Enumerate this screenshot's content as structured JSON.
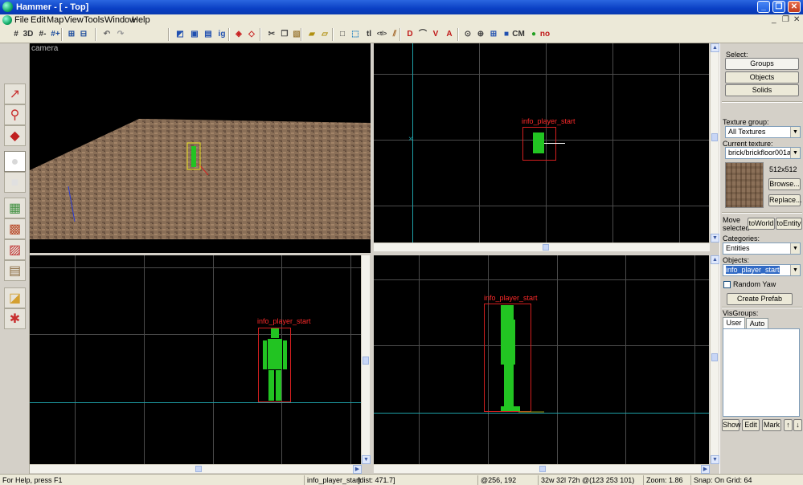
{
  "window": {
    "title": "Hammer - [ - Top]",
    "minimize": "_",
    "restore": "❐",
    "close": "✕"
  },
  "menu": {
    "items": [
      "File",
      "Edit",
      "Map",
      "View",
      "Tools",
      "Window",
      "Help"
    ],
    "mdi_min": "_",
    "mdi_restore": "❐",
    "mdi_close": "✕"
  },
  "toolbar": {
    "buttons": [
      {
        "name": "grid-toggle-icon",
        "glyph": "#"
      },
      {
        "name": "3d-grid-icon",
        "glyph": "3D"
      },
      {
        "name": "grid-smaller-icon",
        "glyph": "#-"
      },
      {
        "name": "grid-larger-icon",
        "glyph": "#+"
      },
      {
        "name": "group-icon",
        "glyph": "⊞"
      },
      {
        "name": "ungroup-icon",
        "glyph": "⊟"
      },
      {
        "name": "undo-icon",
        "glyph": "↶"
      },
      {
        "name": "redo-icon",
        "glyph": "↷"
      },
      {
        "name": "compile-icon",
        "glyph": "◩"
      },
      {
        "name": "hide-selection-icon",
        "glyph": "▣"
      },
      {
        "name": "show-all-icon",
        "glyph": "▤"
      },
      {
        "name": "ig-icon",
        "glyph": "ig"
      },
      {
        "name": "carve-icon",
        "glyph": "◈"
      },
      {
        "name": "make-hollow-icon",
        "glyph": "◇"
      },
      {
        "name": "cut-icon",
        "glyph": "✂"
      },
      {
        "name": "copy-icon",
        "glyph": "❐"
      },
      {
        "name": "paste-icon",
        "glyph": "▧"
      },
      {
        "name": "texture-lock-icon",
        "glyph": "▰"
      },
      {
        "name": "texture-scale-lock-icon",
        "glyph": "▱"
      },
      {
        "name": "select-box-icon",
        "glyph": "□"
      },
      {
        "name": "select-cursor-icon",
        "glyph": "⬚"
      },
      {
        "name": "texture-apply-icon",
        "glyph": "tl"
      },
      {
        "name": "flip-icon",
        "glyph": "<tl>"
      },
      {
        "name": "clip-icon",
        "glyph": "⫽"
      },
      {
        "name": "toggle-3d-red-icon",
        "glyph": "D"
      },
      {
        "name": "vertex-icon",
        "glyph": "⌒"
      },
      {
        "name": "toggle-models-icon",
        "glyph": "V"
      },
      {
        "name": "toggle-helpers-icon",
        "glyph": "A"
      },
      {
        "name": "cordon-icon",
        "glyph": "⊙"
      },
      {
        "name": "autovis-icon",
        "glyph": "⊕"
      },
      {
        "name": "grid-3d-icon",
        "glyph": "⊞"
      },
      {
        "name": "color-icon",
        "glyph": "■"
      },
      {
        "name": "cm-icon",
        "glyph": "CM"
      },
      {
        "name": "leaf-icon",
        "glyph": "●"
      },
      {
        "name": "no-draw-icon",
        "glyph": "no"
      }
    ]
  },
  "palette": {
    "tools": [
      {
        "name": "selection-tool-icon",
        "glyph": "↗"
      },
      {
        "name": "magnify-tool-icon",
        "glyph": "⚲"
      },
      {
        "name": "camera-tool-icon",
        "glyph": "◆"
      },
      {
        "name": "entity-tool-icon",
        "glyph": "●"
      },
      {
        "name": "block-tool-icon",
        "glyph": "■"
      },
      {
        "name": "texture-tool-icon",
        "glyph": "▦"
      },
      {
        "name": "apply-texture-tool-icon",
        "glyph": "▩"
      },
      {
        "name": "decal-tool-icon",
        "glyph": "▨"
      },
      {
        "name": "overlay-tool-icon",
        "glyph": "▤"
      },
      {
        "name": "clip-tool-icon",
        "glyph": "◪"
      },
      {
        "name": "vertex-tool-icon",
        "glyph": "✱"
      }
    ]
  },
  "viewports": {
    "camera": {
      "label": "camera"
    },
    "top": {
      "entity_label": "info_player_start"
    },
    "front": {
      "entity_label": "info_player_start"
    },
    "side": {
      "entity_label": "info_player_start"
    }
  },
  "right_panel": {
    "select_label": "Select:",
    "select_buttons": [
      "Groups",
      "Objects",
      "Solids"
    ],
    "texture_group_label": "Texture group:",
    "texture_group_value": "All Textures",
    "current_texture_label": "Current texture:",
    "current_texture_value": "brick/brickfloor001a",
    "texture_size": "512x512",
    "browse_label": "Browse...",
    "replace_label": "Replace...",
    "move_selected_label": "Move selected",
    "to_world_label": "toWorld",
    "to_entity_label": "toEntity",
    "categories_label": "Categories:",
    "categories_value": "Entities",
    "objects_label": "Objects:",
    "objects_value": "info_player_start",
    "random_yaw_label": "Random Yaw",
    "create_prefab_label": "Create Prefab",
    "visgroups_label": "VisGroups:",
    "tabs": [
      "User",
      "Auto"
    ],
    "bottom_buttons": [
      "Show",
      "Edit",
      "Mark"
    ],
    "up_arrow": "↑",
    "down_arrow": "↓"
  },
  "status": {
    "help": "For Help, press F1",
    "selection": "info_player_start",
    "dist": "[dist: 471.7]",
    "coords": "@256, 192",
    "size": "32w 32l 72h @(123 253 101)",
    "zoom": "Zoom: 1.86",
    "snap": "Snap: On Grid: 64"
  },
  "colors": {
    "accent": "#0a3fc4",
    "entity_box": "#d41f1f",
    "entity_label": "#ff2a2a",
    "axis": "#1e9fa6",
    "player_model": "#22c422",
    "grid": "#4c4c4c"
  }
}
